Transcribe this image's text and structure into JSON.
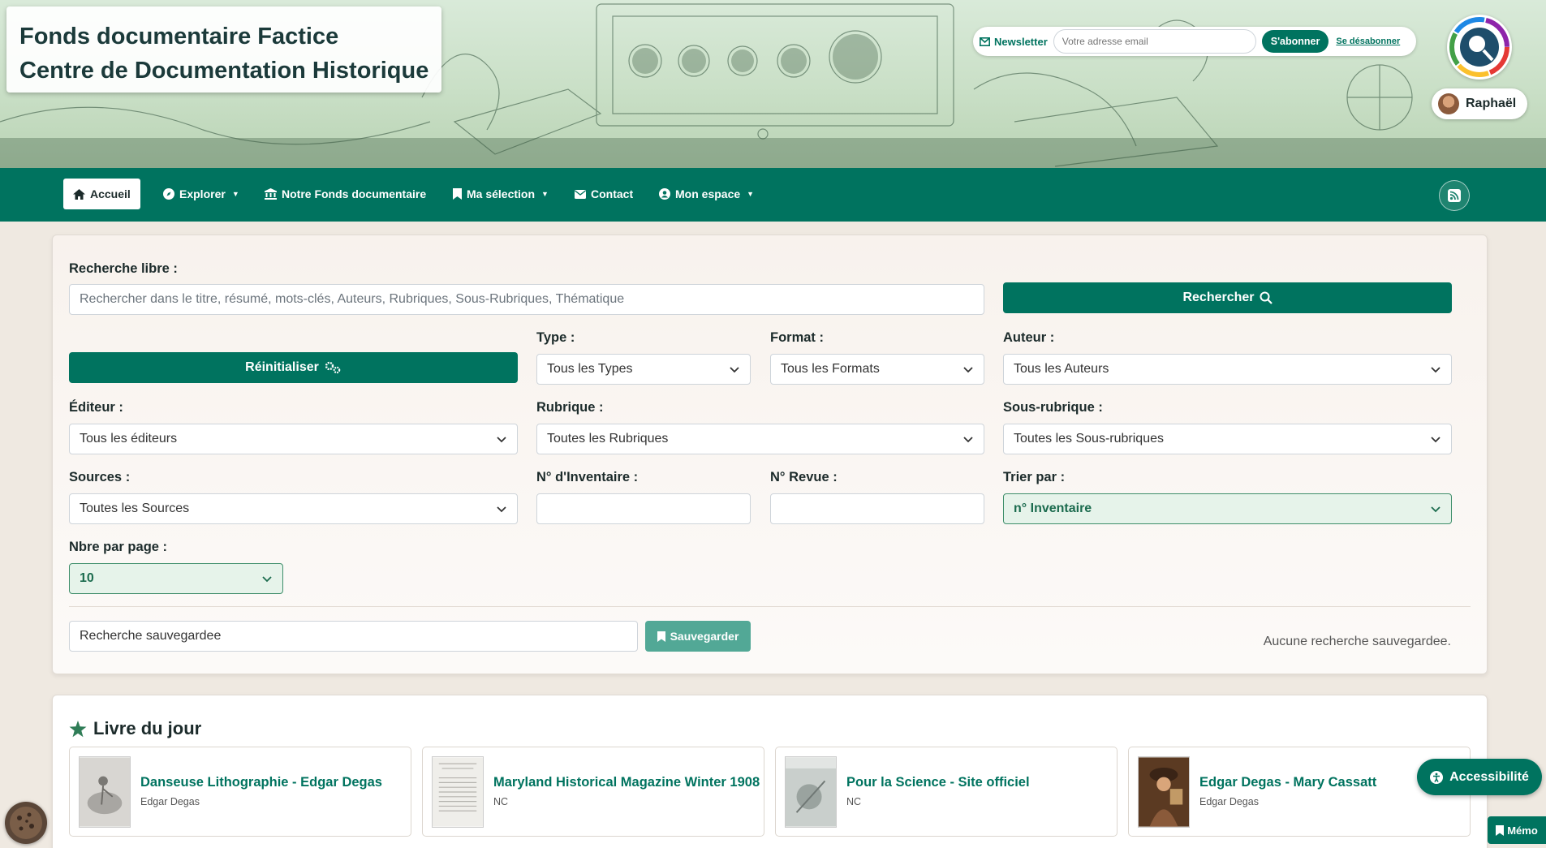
{
  "site": {
    "title_line1": "Fonds documentaire Factice",
    "title_line2": "Centre de Documentation Historique"
  },
  "newsletter": {
    "label": "Newsletter",
    "email_placeholder": "Votre adresse email",
    "subscribe": "S'abonner",
    "unsubscribe": "Se désabonner"
  },
  "user": {
    "name": "Raphaël"
  },
  "nav": {
    "home": "Accueil",
    "explore": "Explorer",
    "collection": "Notre Fonds documentaire",
    "selection": "Ma sélection",
    "contact": "Contact",
    "space": "Mon espace"
  },
  "search": {
    "free_label": "Recherche libre :",
    "free_placeholder": "Rechercher dans le titre, résumé, mots-clés, Auteurs, Rubriques, Sous-Rubriques, Thématique",
    "search_button": "Rechercher",
    "reset_button": "Réinitialiser",
    "type_label": "Type :",
    "type_value": "Tous les Types",
    "format_label": "Format :",
    "format_value": "Tous les Formats",
    "author_label": "Auteur :",
    "author_value": "Tous les Auteurs",
    "publisher_label": "Éditeur :",
    "publisher_value": "Tous les éditeurs",
    "rubric_label": "Rubrique :",
    "rubric_value": "Toutes les Rubriques",
    "subrubric_label": "Sous-rubrique :",
    "subrubric_value": "Toutes les Sous-rubriques",
    "sources_label": "Sources :",
    "sources_value": "Toutes les Sources",
    "inventory_label": "N° d'Inventaire :",
    "inventory_value": "",
    "journal_label": "N° Revue :",
    "journal_value": "",
    "sort_label": "Trier par :",
    "sort_value": "n° Inventaire",
    "per_page_label": "Nbre par page :",
    "per_page_value": "10",
    "saved_search_value": "Recherche sauvegardee",
    "save_button": "Sauvegarder",
    "no_saved": "Aucune recherche sauvegardee."
  },
  "book_of_day": {
    "heading": "Livre du jour",
    "books": [
      {
        "title": "Danseuse Lithographie - Edgar Degas",
        "author": "Edgar Degas"
      },
      {
        "title": "Maryland Historical Magazine Winter 1908",
        "author": "NC"
      },
      {
        "title": "Pour la Science - Site officiel",
        "author": "NC"
      },
      {
        "title": "Edgar Degas - Mary Cassatt",
        "author": "Edgar Degas"
      }
    ]
  },
  "floating": {
    "accessibility": "Accessibilité",
    "memo": "Mémo"
  },
  "colors": {
    "primary": "#00735f",
    "save_button": "#52a896",
    "banner_tint": "#c9dfc6"
  }
}
